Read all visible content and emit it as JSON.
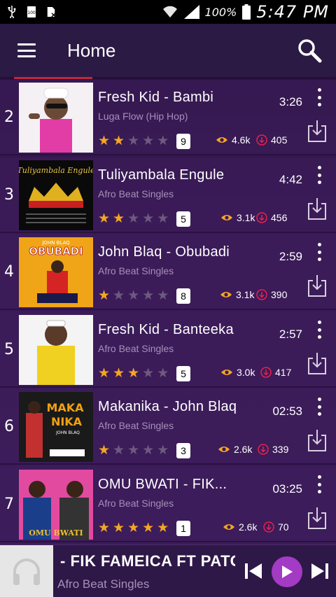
{
  "status_bar": {
    "battery_percent": "100%",
    "time": "5:47 PM"
  },
  "app_bar": {
    "title": "Home"
  },
  "songs": [
    {
      "rank": "2",
      "title": "Fresh Kid - Bambi",
      "duration": "3:26",
      "genre": "Luga Flow (Hip Hop)",
      "rating": 2,
      "rating_count": "9",
      "views": "4.6k",
      "downloads": "405"
    },
    {
      "rank": "3",
      "title": "Tuliyambala Engule",
      "duration": "4:42",
      "genre": "Afro Beat Singles",
      "rating": 2,
      "rating_count": "5",
      "views": "3.1k",
      "downloads": "456",
      "art_text": "Tuliyambala Engule"
    },
    {
      "rank": "4",
      "title": "John Blaq - Obubadi",
      "duration": "2:59",
      "genre": "Afro Beat Singles",
      "rating": 1,
      "rating_count": "8",
      "views": "3.1k",
      "downloads": "390",
      "art_text": "OBUBADI",
      "art_text_top": "JOHN BLAQ"
    },
    {
      "rank": "5",
      "title": "Fresh Kid - Banteeka",
      "duration": "2:57",
      "genre": "Afro Beat Singles",
      "rating": 3,
      "rating_count": "5",
      "views": "3.0k",
      "downloads": "417"
    },
    {
      "rank": "6",
      "title": "Makanika - John Blaq",
      "duration": "02:53",
      "genre": "Afro Beat Singles",
      "rating": 1,
      "rating_count": "3",
      "views": "2.6k",
      "downloads": "339",
      "art_text": "MAKA NIKA",
      "art_text_sub": "JOHN BLAQ"
    },
    {
      "rank": "7",
      "title": "OMU BWATI - FIK...",
      "duration": "03:25",
      "genre": "Afro Beat Singles",
      "rating": 5,
      "rating_count": "1",
      "views": "2.6k",
      "downloads": "70",
      "art_text": "OMU BWATI"
    }
  ],
  "player": {
    "title": "- FIK FAMEICA FT PATORANKING",
    "subtitle": "Afro Beat Singles"
  },
  "colors": {
    "accent": "#a43bc4",
    "star": "#f5a623",
    "download": "#e8204f",
    "views_eye": "#f5a623"
  }
}
